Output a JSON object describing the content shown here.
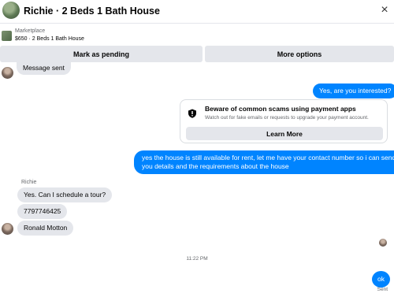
{
  "header": {
    "title": "Richie · 2 Beds 1 Bath House",
    "close_glyph": "×",
    "avatar_icon": "profile-photo"
  },
  "listing": {
    "kicker": "Marketplace",
    "description": "$650 · 2 Beds 1 Bath House"
  },
  "actions": {
    "mark_pending": "Mark as pending",
    "more_options": "More options"
  },
  "messages": {
    "message_sent": "Message sent",
    "out_interested": "Yes, are you interested?",
    "out_long_1": "yes the house is still available for rent, let me have your contact number so i can send",
    "out_long_2": "you details and the requirements about the house",
    "sender_name": "Richie",
    "in_tour": "Yes. Can I schedule a tour?",
    "in_phone": "7797746425",
    "in_name": "Ronald Motton",
    "timestamp": "11:22 PM",
    "out_ok": "ok",
    "sent_status": "Sent"
  },
  "scam_card": {
    "title": "Beware of common scams using payment apps",
    "text": "Watch out for fake emails or requests to upgrade your payment account.",
    "button": "Learn More",
    "icon": "shield-icon"
  },
  "colors": {
    "outgoing_bubble": "#0084ff",
    "incoming_bubble": "#e4e6eb",
    "secondary_text": "#65676b"
  }
}
